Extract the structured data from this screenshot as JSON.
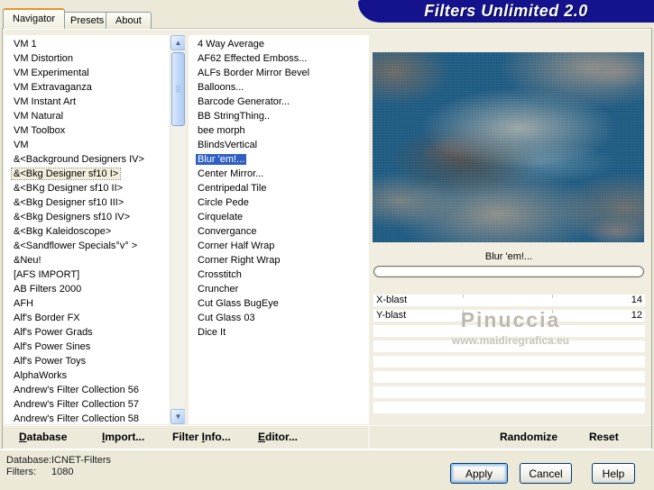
{
  "window": {
    "title": "Filters Unlimited 2.0"
  },
  "tabs": {
    "navigator": "Navigator",
    "presets": "Presets",
    "about": "About"
  },
  "category_list": {
    "selected_index": 9,
    "items": [
      "VM 1",
      "VM Distortion",
      "VM Experimental",
      "VM Extravaganza",
      "VM Instant Art",
      "VM Natural",
      "VM Toolbox",
      "VM",
      "&<Background Designers IV>",
      "&<Bkg Designer sf10 I>",
      "&<BKg Designer sf10 II>",
      "&<Bkg Designer sf10 III>",
      "&<Bkg Designers sf10 IV>",
      "&<Bkg Kaleidoscope>",
      "&<Sandflower Specials°v° >",
      "&Neu!",
      "[AFS IMPORT]",
      "AB Filters 2000",
      "AFH",
      "Alf's Border FX",
      "Alf's Power Grads",
      "Alf's Power Sines",
      "Alf's Power Toys",
      "AlphaWorks",
      "Andrew's Filter Collection 56",
      "Andrew's Filter Collection 57",
      "Andrew's Filter Collection 58"
    ]
  },
  "filter_list": {
    "selected_index": 8,
    "items": [
      "4 Way Average",
      "AF62 Effected Emboss...",
      "ALFs Border Mirror Bevel",
      "Balloons...",
      "Barcode Generator...",
      "BB StringThing..",
      "bee morph",
      "BlindsVertical",
      "Blur 'em!...",
      "Center Mirror...",
      "Centripedal Tile",
      "Circle Pede",
      "Cirquelate",
      "Convergance",
      "Corner Half Wrap",
      "Corner Right Wrap",
      "Crosstitch",
      "Cruncher",
      "Cut Glass  BugEye",
      "Cut Glass 03",
      "Dice It"
    ]
  },
  "preview": {
    "filter_label": "Blur 'em!...",
    "watermark_name": "Pinuccia",
    "watermark_site": "www.maidiregrafica.eu"
  },
  "parameters": [
    {
      "name": "X-blast",
      "value": "14"
    },
    {
      "name": "Y-blast",
      "value": "12"
    }
  ],
  "command_bar": {
    "database": {
      "label": "Database",
      "key": "D"
    },
    "import": {
      "label": "Import...",
      "key": "I"
    },
    "filter_info": {
      "label": "Filter Info...",
      "key": "I"
    },
    "editor": {
      "label": "Editor...",
      "key": "E"
    },
    "randomize": "Randomize",
    "reset": "Reset"
  },
  "status": {
    "database_label": "Database:",
    "database_value": "ICNET-Filters",
    "filters_label": "Filters:",
    "filters_value": "1080"
  },
  "dialog_buttons": {
    "apply": "Apply",
    "cancel": "Cancel",
    "help": "Help"
  },
  "colors": {
    "window_bg": "#ECE9D8",
    "title_bar": "#14138D",
    "selection": "#2F5FC5",
    "tab_accent": "#E5952E",
    "preview_base": "#1B5880"
  }
}
